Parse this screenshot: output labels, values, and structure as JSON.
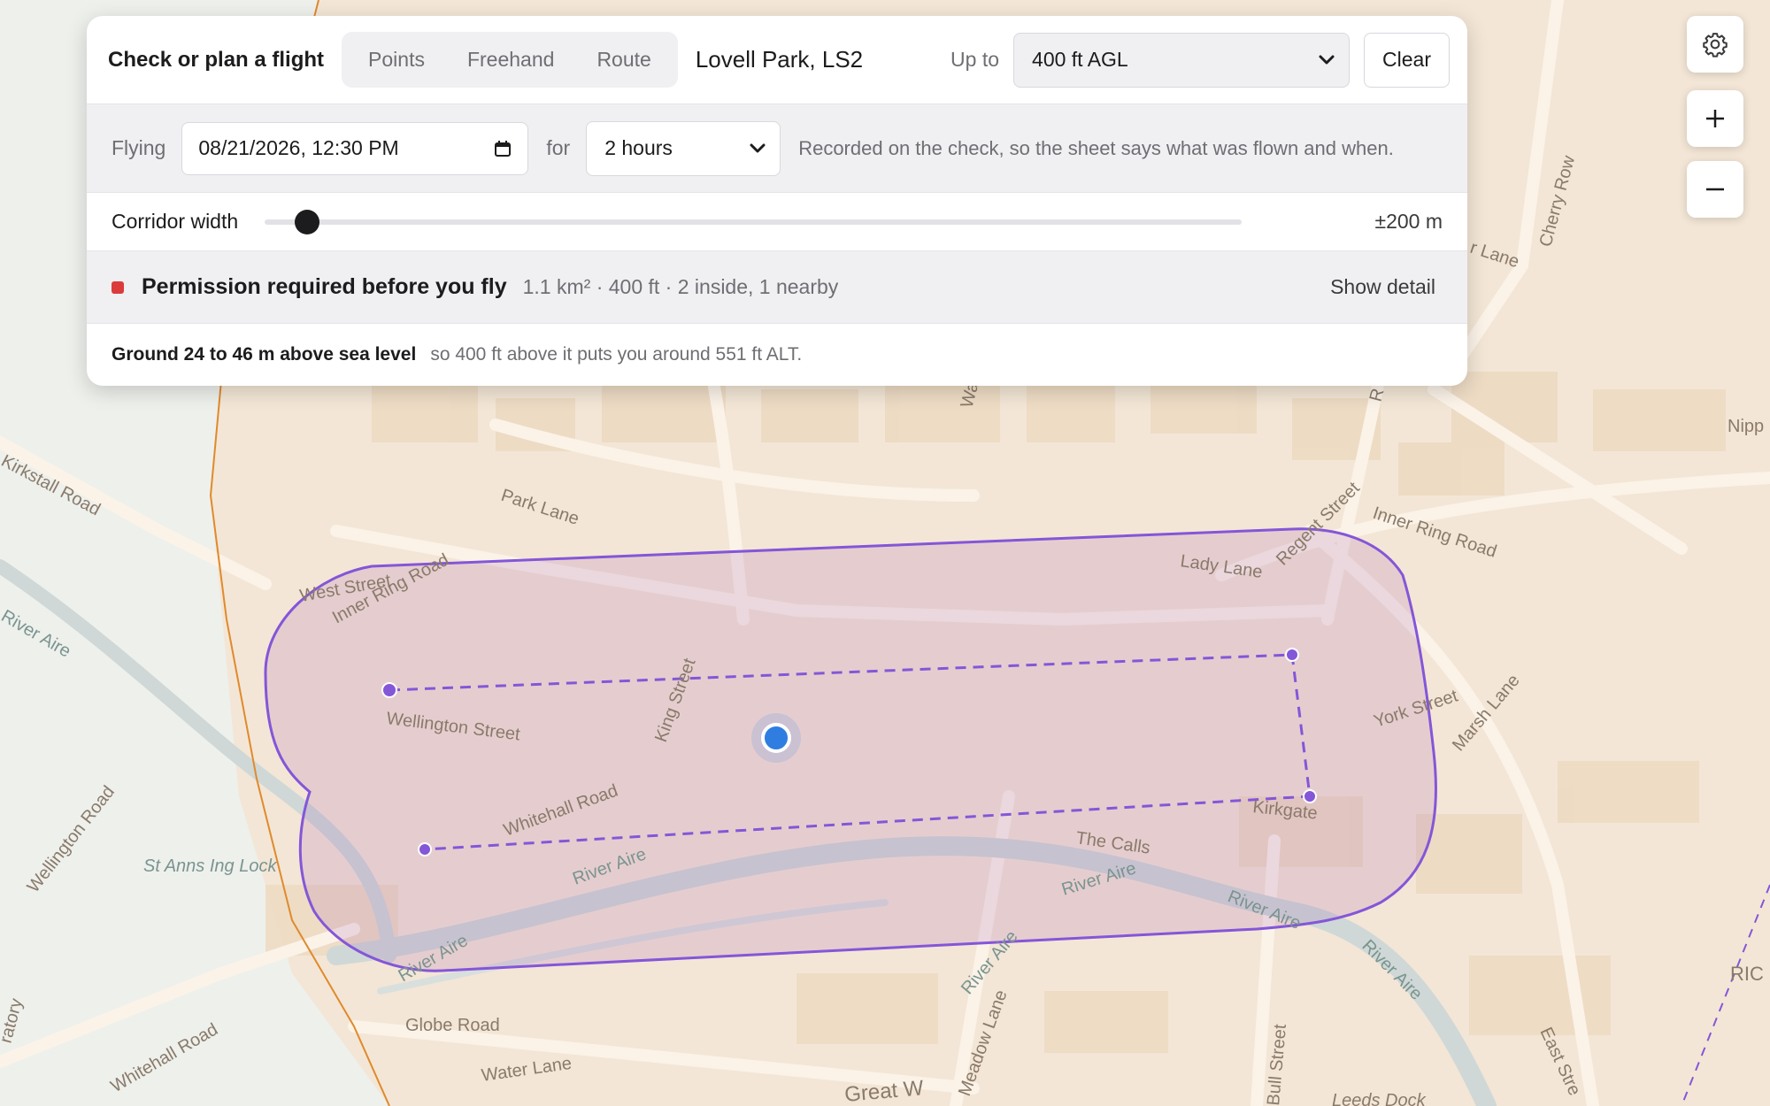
{
  "panel": {
    "title": "Check or plan a flight",
    "modes": [
      "Points",
      "Freehand",
      "Route"
    ],
    "location": "Lovell Park, LS2",
    "altitude_label": "Up to",
    "altitude_value": "400 ft AGL",
    "clear_label": "Clear",
    "flying_label": "Flying",
    "datetime_value": "08/21/2026, 12:30 PM",
    "for_label": "for",
    "duration_value": "2 hours",
    "record_note": "Recorded on the check, so the sheet says what was flown and when.",
    "corridor_label": "Corridor width",
    "corridor_value": "±200 m",
    "status_title": "Permission required before you fly",
    "status_meta": "1.1 km² · 400 ft · 2 inside, 1 nearby",
    "status_color": "#dc3b3b",
    "show_detail_label": "Show detail",
    "ground_title": "Ground 24 to 46 m above sea level",
    "ground_note": "so 400 ft above it puts you around 551 ft ALT."
  },
  "map_controls": {
    "settings_icon": "gear-icon",
    "zoom_in_icon": "plus-icon",
    "zoom_out_icon": "minus-icon"
  },
  "map": {
    "streets": {
      "kirkstall_road": "Kirkstall Road",
      "river_aire": "River Aire",
      "wellington_road": "Wellington Road",
      "st_anns": "St Anns Ing Lock",
      "atory": "ratory",
      "whitehall_road_sw": "Whitehall Road",
      "park_lane": "Park Lane",
      "west_street": "West Street",
      "inner_ring_road_w": "Inner Ring Road",
      "wellington_street": "Wellington Street",
      "king_street": "King Street",
      "whitehall_road": "Whitehall Road",
      "river_aire_1": "River Aire",
      "river_aire_2": "River Aire",
      "river_aire_3": "River Aire",
      "river_aire_4": "River Aire",
      "river_aire_5": "River Aire",
      "the_calls": "The Calls",
      "kirkgate": "Kirkgate",
      "york_street": "York Street",
      "marsh_lane": "Marsh Lane",
      "lady_lane": "Lady Lane",
      "regent_street": "Regent Street",
      "inner_ring_road_e": "Inner Ring Road",
      "cherry_row": "Cherry Row",
      "r_lane": "r Lane",
      "nipp": "Nipp",
      "wa": "Wa",
      "r_frag": "R",
      "globe_road": "Globe Road",
      "water_lane": "Water Lane",
      "meadow_lane": "Meadow Lane",
      "river_aire_6": "River Aire",
      "bull_street": "Bull Street",
      "east_street": "East Stre",
      "leeds_dock": "Leeds Dock",
      "great_w": "Great W",
      "ric": "RIC"
    },
    "colors": {
      "land": "#f3e6d6",
      "urban": "#efdcc4",
      "west_land": "#eef0ec",
      "roads": "#fbf3e8",
      "river": "#cfd8d6",
      "area_fill": "#a65db0",
      "area_stroke": "#8456d8",
      "boundary": "#e08a2b",
      "location": "#2f7de1"
    }
  }
}
